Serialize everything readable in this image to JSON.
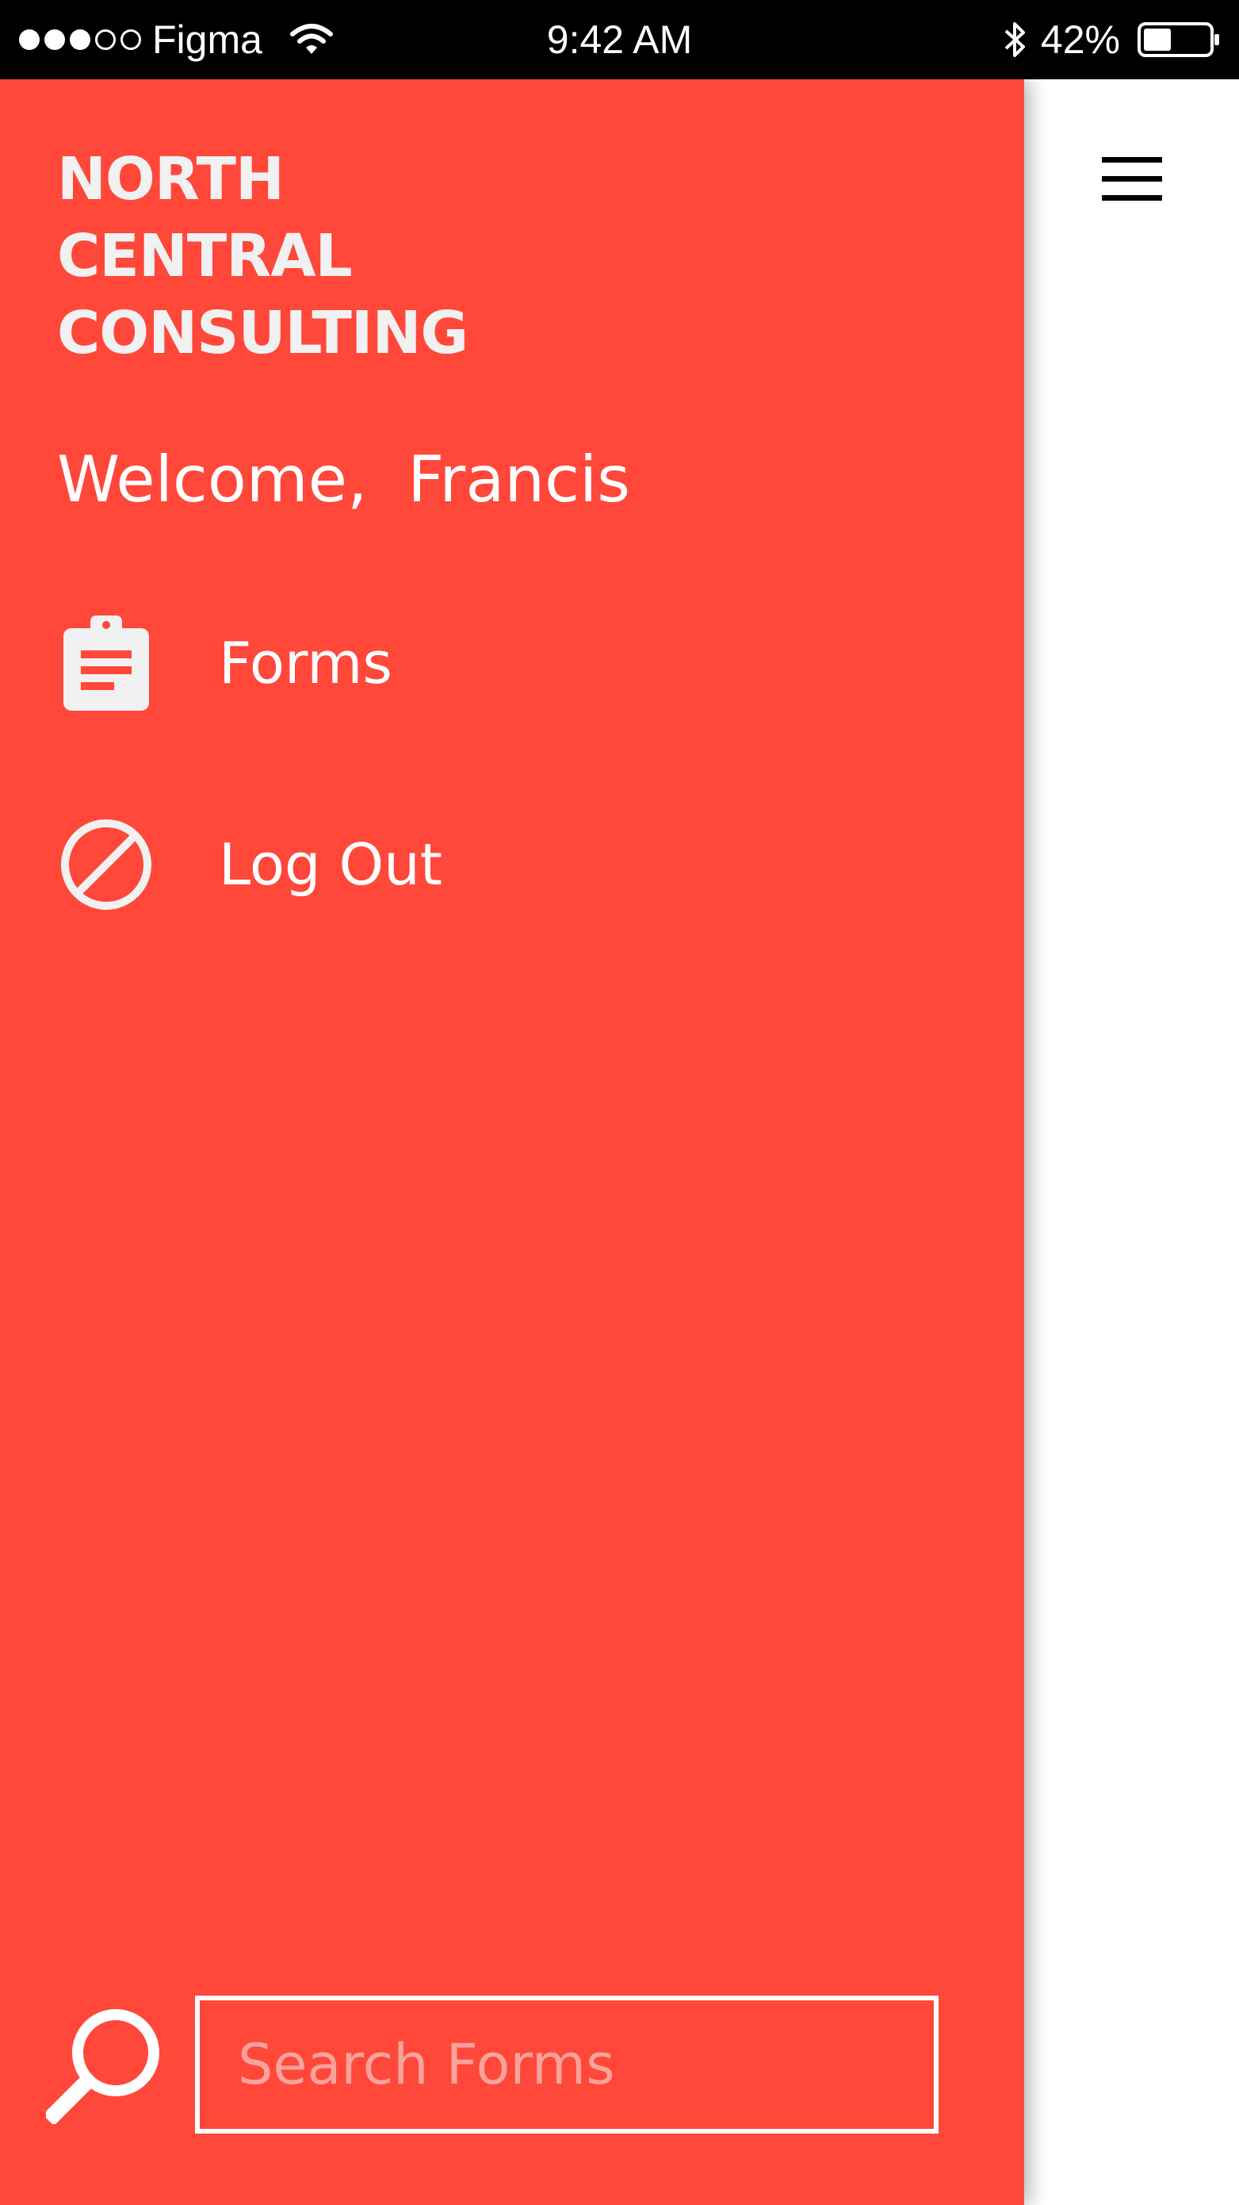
{
  "status_bar": {
    "carrier": "Figma",
    "time": "9:42 AM",
    "battery": "42%",
    "signal": {
      "filled": 3,
      "total": 5
    },
    "battery_level": 0.42
  },
  "drawer": {
    "brand_lines": [
      "NORTH",
      "CENTRAL",
      "CONSULTING"
    ],
    "welcome": "Welcome,  Francis",
    "nav": [
      {
        "label": "Forms",
        "icon": "clipboard-icon"
      },
      {
        "label": "Log Out",
        "icon": "block-icon"
      }
    ],
    "search": {
      "placeholder": "Search Forms",
      "value": ""
    }
  },
  "colors": {
    "drawer_bg": "#ff473a",
    "text": "#ffffff",
    "status_bar_bg": "#000000",
    "placeholder": "#f7a39c"
  },
  "icons": {
    "menu": "hamburger-menu-icon",
    "search": "search-icon",
    "wifi": "wifi-icon",
    "bluetooth": "bluetooth-icon",
    "battery": "battery-icon"
  }
}
